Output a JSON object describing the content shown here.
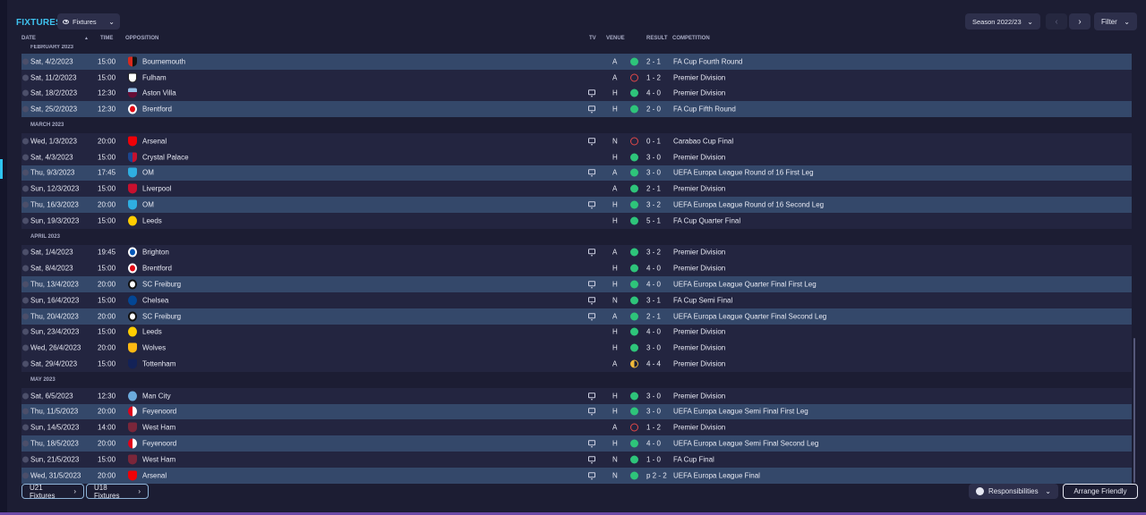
{
  "header": {
    "title": "FIXTURES",
    "view_dropdown": "Fixtures",
    "season_dropdown": "Season 2022/23",
    "filter_label": "Filter"
  },
  "columns": {
    "date": "DATE",
    "time": "TIME",
    "opposition": "OPPOSITION",
    "tv": "TV",
    "venue": "VENUE",
    "result": "RESULT",
    "competition": "COMPETITION"
  },
  "months": {
    "feb": "FEBRUARY 2023",
    "mar": "MARCH 2023",
    "apr": "APRIL 2023",
    "may": "MAY 2023"
  },
  "fixtures": [
    {
      "date": "Sat, 4/2/2023",
      "time": "15:00",
      "opponent": "Bournemouth",
      "badge": "bournemouth",
      "tv": false,
      "venue": "A",
      "result": "win",
      "score": "2 - 1",
      "competition": "FA Cup Fourth Round"
    },
    {
      "date": "Sat, 11/2/2023",
      "time": "15:00",
      "opponent": "Fulham",
      "badge": "fulham",
      "tv": false,
      "venue": "A",
      "result": "loss",
      "score": "1 - 2",
      "competition": "Premier Division"
    },
    {
      "date": "Sat, 18/2/2023",
      "time": "12:30",
      "opponent": "Aston Villa",
      "badge": "villa",
      "tv": true,
      "venue": "H",
      "result": "win",
      "score": "4 - 0",
      "competition": "Premier Division"
    },
    {
      "date": "Sat, 25/2/2023",
      "time": "12:30",
      "opponent": "Brentford",
      "badge": "brentford",
      "tv": true,
      "venue": "H",
      "result": "win",
      "score": "2 - 0",
      "competition": "FA Cup Fifth Round"
    },
    {
      "date": "Wed, 1/3/2023",
      "time": "20:00",
      "opponent": "Arsenal",
      "badge": "arsenal",
      "tv": true,
      "venue": "N",
      "result": "loss",
      "score": "0 - 1",
      "competition": "Carabao Cup Final"
    },
    {
      "date": "Sat, 4/3/2023",
      "time": "15:00",
      "opponent": "Crystal Palace",
      "badge": "palace",
      "tv": false,
      "venue": "H",
      "result": "win",
      "score": "3 - 0",
      "competition": "Premier Division"
    },
    {
      "date": "Thu, 9/3/2023",
      "time": "17:45",
      "opponent": "OM",
      "badge": "om",
      "tv": true,
      "venue": "A",
      "result": "win",
      "score": "3 - 0",
      "competition": "UEFA Europa League Round of 16  First Leg"
    },
    {
      "date": "Sun, 12/3/2023",
      "time": "15:00",
      "opponent": "Liverpool",
      "badge": "liverpool",
      "tv": false,
      "venue": "A",
      "result": "win",
      "score": "2 - 1",
      "competition": "Premier Division"
    },
    {
      "date": "Thu, 16/3/2023",
      "time": "20:00",
      "opponent": "OM",
      "badge": "om",
      "tv": true,
      "venue": "H",
      "result": "win",
      "score": "3 - 2",
      "competition": "UEFA Europa League Round of 16  Second Leg"
    },
    {
      "date": "Sun, 19/3/2023",
      "time": "15:00",
      "opponent": "Leeds",
      "badge": "leeds",
      "tv": false,
      "venue": "H",
      "result": "win",
      "score": "5 - 1",
      "competition": "FA Cup Quarter Final"
    },
    {
      "date": "Sat, 1/4/2023",
      "time": "19:45",
      "opponent": "Brighton",
      "badge": "brighton",
      "tv": true,
      "venue": "A",
      "result": "win",
      "score": "3 - 2",
      "competition": "Premier Division"
    },
    {
      "date": "Sat, 8/4/2023",
      "time": "15:00",
      "opponent": "Brentford",
      "badge": "brentford",
      "tv": false,
      "venue": "H",
      "result": "win",
      "score": "4 - 0",
      "competition": "Premier Division"
    },
    {
      "date": "Thu, 13/4/2023",
      "time": "20:00",
      "opponent": "SC Freiburg",
      "badge": "freiburg",
      "tv": true,
      "venue": "H",
      "result": "win",
      "score": "4 - 0",
      "competition": "UEFA Europa League Quarter Final First Leg"
    },
    {
      "date": "Sun, 16/4/2023",
      "time": "15:00",
      "opponent": "Chelsea",
      "badge": "chelsea",
      "tv": true,
      "venue": "N",
      "result": "win",
      "score": "3 - 1",
      "competition": "FA Cup Semi Final"
    },
    {
      "date": "Thu, 20/4/2023",
      "time": "20:00",
      "opponent": "SC Freiburg",
      "badge": "freiburg",
      "tv": true,
      "venue": "A",
      "result": "win",
      "score": "2 - 1",
      "competition": "UEFA Europa League Quarter Final Second Leg"
    },
    {
      "date": "Sun, 23/4/2023",
      "time": "15:00",
      "opponent": "Leeds",
      "badge": "leeds",
      "tv": false,
      "venue": "H",
      "result": "win",
      "score": "4 - 0",
      "competition": "Premier Division"
    },
    {
      "date": "Wed, 26/4/2023",
      "time": "20:00",
      "opponent": "Wolves",
      "badge": "wolves",
      "tv": false,
      "venue": "H",
      "result": "win",
      "score": "3 - 0",
      "competition": "Premier Division"
    },
    {
      "date": "Sat, 29/4/2023",
      "time": "15:00",
      "opponent": "Tottenham",
      "badge": "spurs",
      "tv": false,
      "venue": "A",
      "result": "draw",
      "score": "4 - 4",
      "competition": "Premier Division"
    },
    {
      "date": "Sat, 6/5/2023",
      "time": "12:30",
      "opponent": "Man City",
      "badge": "mancity",
      "tv": true,
      "venue": "H",
      "result": "win",
      "score": "3 - 0",
      "competition": "Premier Division"
    },
    {
      "date": "Thu, 11/5/2023",
      "time": "20:00",
      "opponent": "Feyenoord",
      "badge": "feyenoord",
      "tv": true,
      "venue": "H",
      "result": "win",
      "score": "3 - 0",
      "competition": "UEFA Europa League Semi Final First Leg"
    },
    {
      "date": "Sun, 14/5/2023",
      "time": "14:00",
      "opponent": "West Ham",
      "badge": "westham",
      "tv": false,
      "venue": "A",
      "result": "loss",
      "score": "1 - 2",
      "competition": "Premier Division"
    },
    {
      "date": "Thu, 18/5/2023",
      "time": "20:00",
      "opponent": "Feyenoord",
      "badge": "feyenoord",
      "tv": true,
      "venue": "H",
      "result": "win",
      "score": "4 - 0",
      "competition": "UEFA Europa League Semi Final Second Leg"
    },
    {
      "date": "Sun, 21/5/2023",
      "time": "15:00",
      "opponent": "West Ham",
      "badge": "westham",
      "tv": true,
      "venue": "N",
      "result": "win",
      "score": "1 - 0",
      "competition": "FA Cup Final"
    },
    {
      "date": "Wed, 31/5/2023",
      "time": "20:00",
      "opponent": "Arsenal",
      "badge": "arsenal",
      "tv": true,
      "venue": "N",
      "result": "win",
      "score": "p 2 - 2",
      "competition": "UEFA Europa League Final"
    }
  ],
  "footer": {
    "u21": "U21 Fixtures",
    "u18": "U18 Fixtures",
    "responsibilities": "Responsibilities",
    "arrange_friendly": "Arrange Friendly"
  },
  "colors": {
    "accent": "#3fc3ef",
    "win": "#2ec47a",
    "loss": "#e04848",
    "draw": "#f0b93a",
    "row_highlight": "#34486a"
  }
}
